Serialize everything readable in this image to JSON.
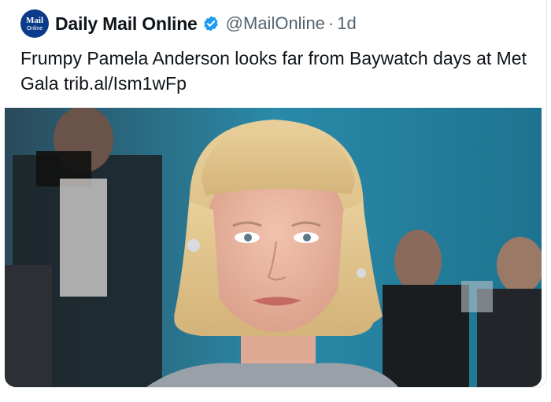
{
  "tweet": {
    "avatar_line1": "Mail",
    "avatar_line2": "Online",
    "author": "Daily Mail Online",
    "handle": "@MailOnline",
    "separator": "·",
    "time": "1d",
    "text": "Frumpy Pamela Anderson looks far from Baywatch days at Met Gala trib.al/Ism1wFp",
    "verified_icon": "verified-badge-icon",
    "avatar_color": "#0a3a8a",
    "verified_color": "#1d9bf0"
  }
}
